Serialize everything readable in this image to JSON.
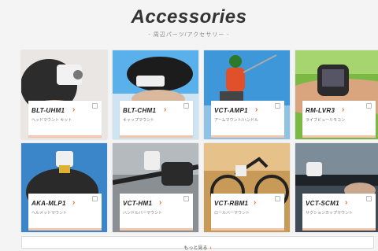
{
  "header": {
    "title": "Accessories",
    "subtitle": "- 周辺パーツ/アクセサリー -"
  },
  "cards": [
    {
      "model": "BLT-UHM1",
      "desc": "ヘッドマウント\nキット"
    },
    {
      "model": "BLT-CHM1",
      "desc": "キャップマウント"
    },
    {
      "model": "VCT-AMP1",
      "desc": "アームマウント/ハンドル"
    },
    {
      "model": "RM-LVR3",
      "desc": "ライブビューリモコン"
    },
    {
      "model": "AKA-MLP1",
      "desc": "ヘルメットマウント"
    },
    {
      "model": "VCT-HM1",
      "desc": "ハンドルバーマウント"
    },
    {
      "model": "VCT-RBM1",
      "desc": "ロールバーマウント"
    },
    {
      "model": "VCT-SCM1",
      "desc": "サクションカップマウント"
    }
  ],
  "more": {
    "label": "もっと見る"
  }
}
